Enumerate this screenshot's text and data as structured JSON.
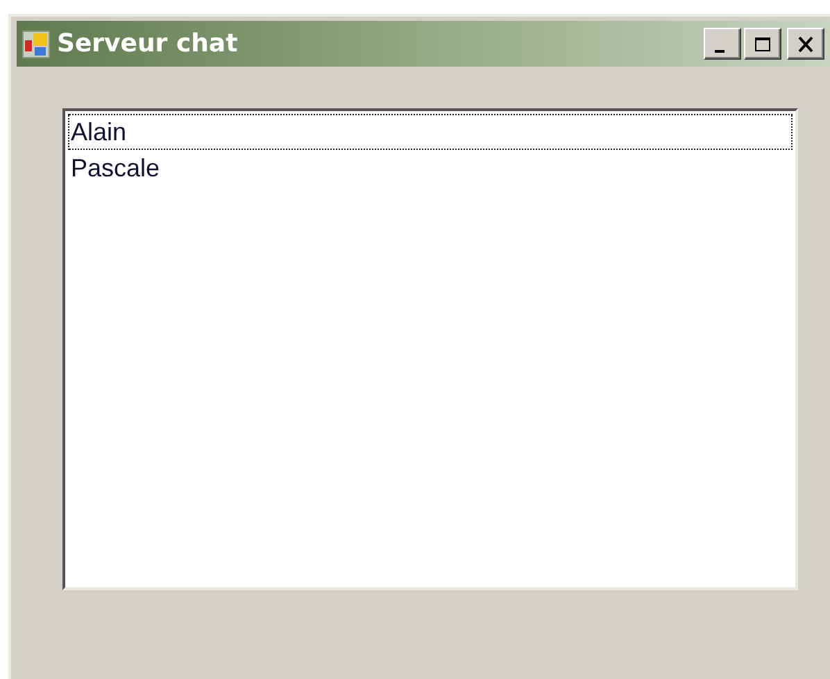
{
  "window": {
    "title": "Serveur chat"
  },
  "title_buttons": [
    {
      "kind": "minimize"
    },
    {
      "kind": "maximize"
    },
    {
      "kind": "close"
    }
  ],
  "list": {
    "items": [
      {
        "label": "Alain",
        "focused": true
      },
      {
        "label": "Pascale",
        "focused": false
      }
    ]
  }
}
